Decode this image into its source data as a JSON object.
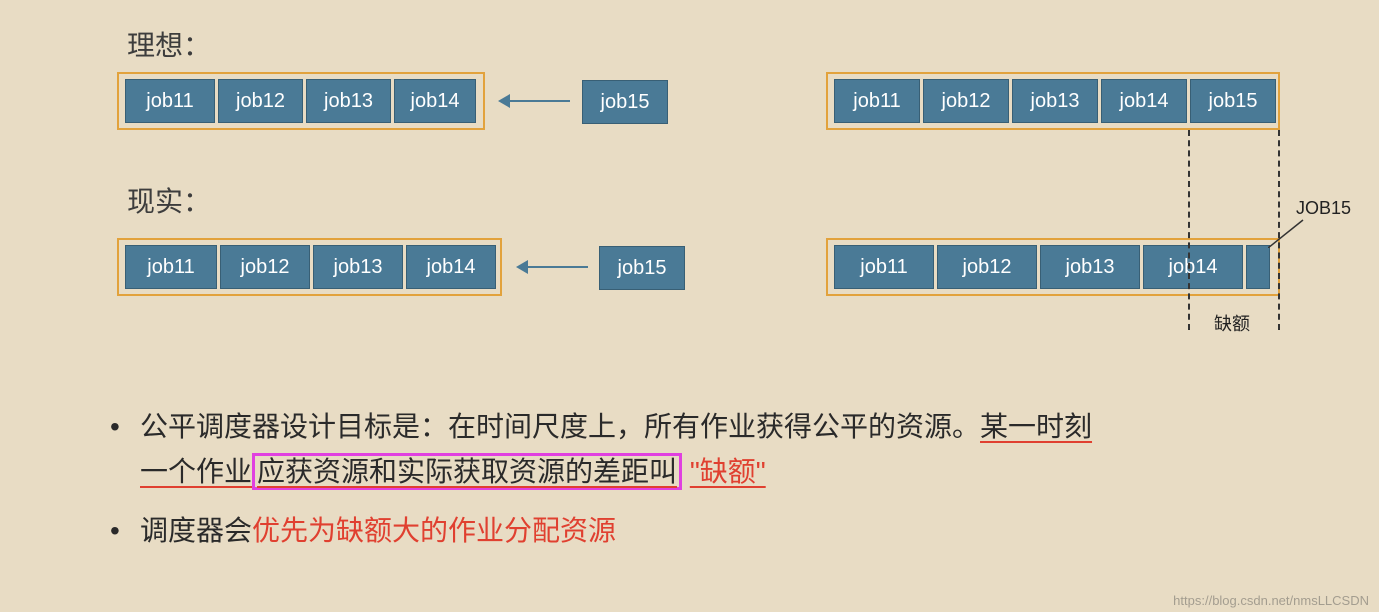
{
  "headings": {
    "ideal": "理想：",
    "real": "现实："
  },
  "jobs": {
    "j11": "job11",
    "j12": "job12",
    "j13": "job13",
    "j14": "job14",
    "j15": "job15"
  },
  "labels": {
    "job15_caps": "JOB15",
    "deficit": "缺额"
  },
  "bullets": {
    "b1_a": "公平调度器设计目标是：在时间尺度上，所有作业获得公平的资源。",
    "b1_b": "某一时刻一个作业",
    "b1_c": "应获资源和实际获取资源的差距叫",
    "b1_d_quote": "\"缺额\"",
    "b2_a": "调度器会",
    "b2_b": "优先为缺额大的作业分配资源"
  },
  "watermark": "https://blog.csdn.net/nmsLLCSDN"
}
